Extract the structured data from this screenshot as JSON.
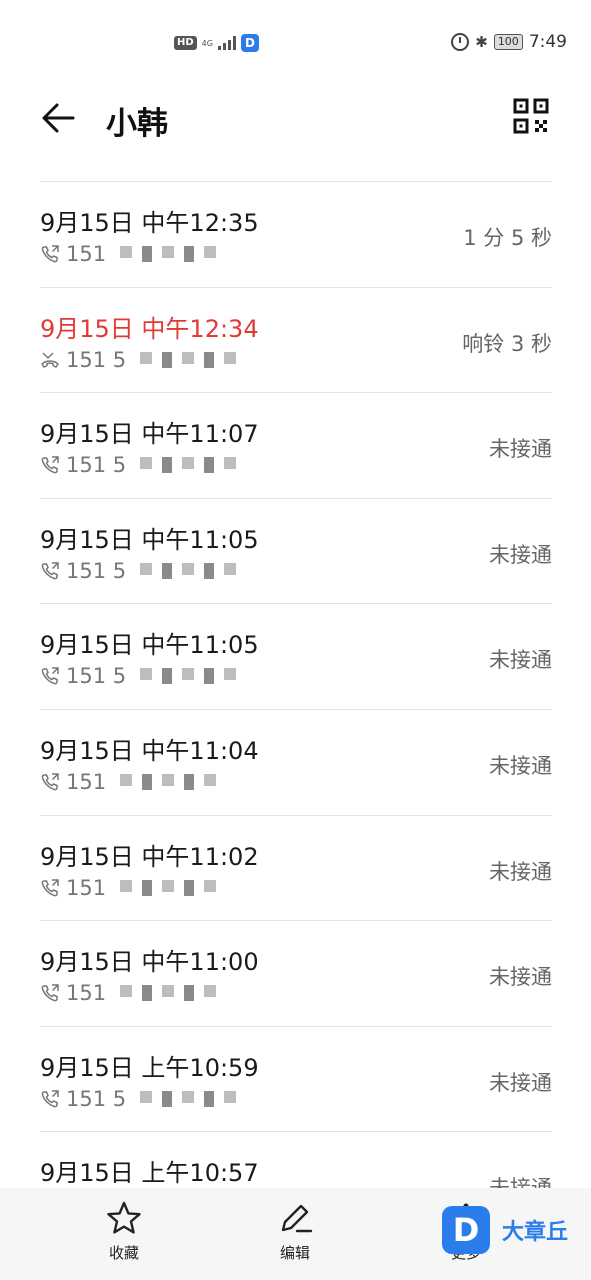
{
  "status_bar": {
    "hd": "HD",
    "network": "4G",
    "app_badge": "D",
    "battery": "100",
    "time": "7:49",
    "icons": [
      "alarm-icon",
      "bluetooth-icon",
      "battery-icon"
    ]
  },
  "header": {
    "title": "小韩",
    "back_icon": "arrow-left-icon",
    "qr_icon": "qr-code-icon"
  },
  "calls": [
    {
      "time": "9月15日 中午12:35",
      "number": "151",
      "status": "1 分 5 秒",
      "type": "outgoing"
    },
    {
      "time": "9月15日 中午12:34",
      "number": "151 5",
      "status": "响铃 3 秒",
      "type": "missed"
    },
    {
      "time": "9月15日 中午11:07",
      "number": "151 5",
      "status": "未接通",
      "type": "outgoing"
    },
    {
      "time": "9月15日 中午11:05",
      "number": "151 5",
      "status": "未接通",
      "type": "outgoing"
    },
    {
      "time": "9月15日 中午11:05",
      "number": "151 5",
      "status": "未接通",
      "type": "outgoing"
    },
    {
      "time": "9月15日 中午11:04",
      "number": "151",
      "status": "未接通",
      "type": "outgoing"
    },
    {
      "time": "9月15日 中午11:02",
      "number": "151",
      "status": "未接通",
      "type": "outgoing"
    },
    {
      "time": "9月15日 中午11:00",
      "number": "151",
      "status": "未接通",
      "type": "outgoing"
    },
    {
      "time": "9月15日 上午10:59",
      "number": "151 5",
      "status": "未接通",
      "type": "outgoing"
    },
    {
      "time": "9月15日 上午10:57",
      "number": "",
      "status": "未接通",
      "type": "outgoing"
    }
  ],
  "bottom_bar": {
    "favorite": "收藏",
    "edit": "编辑",
    "more": "更多"
  },
  "watermark": {
    "logo": "D",
    "text": "大章丘"
  },
  "colors": {
    "missed": "#e03a36",
    "accent": "#2b7de9"
  }
}
